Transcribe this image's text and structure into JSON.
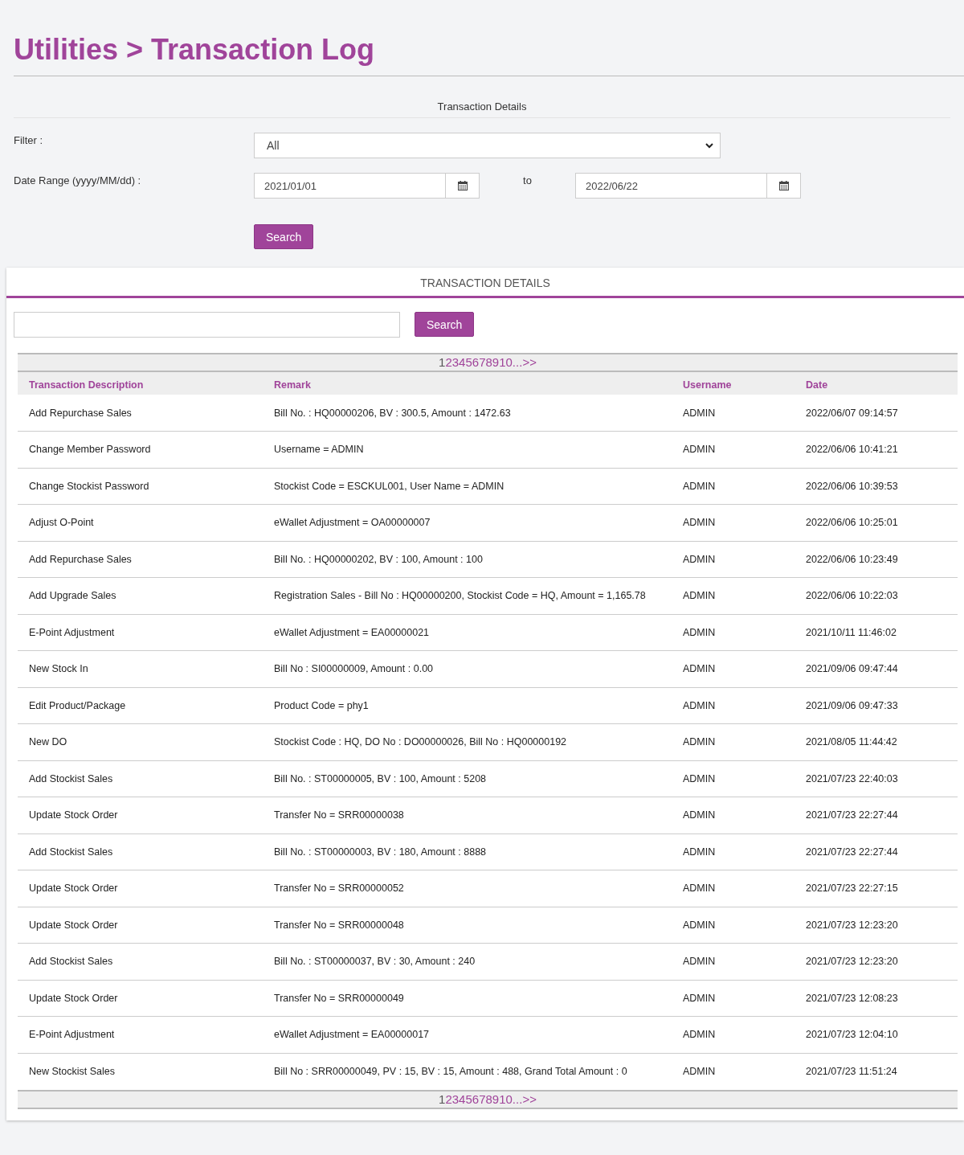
{
  "page_title": "Utilities > Transaction Log",
  "form": {
    "section_title": "Transaction Details",
    "filter_label": "Filter :",
    "filter_value": "All",
    "date_label": "Date Range (yyyy/MM/dd) :",
    "date_from": "2021/01/01",
    "to_label": "to",
    "date_to": "2022/06/22",
    "search_button": "Search"
  },
  "panel": {
    "title": "TRANSACTION DETAILS",
    "search_button": "Search",
    "pager_top": [
      {
        "label": "1",
        "selected": true
      },
      {
        "label": "2",
        "selected": false
      },
      {
        "label": "3",
        "selected": false
      },
      {
        "label": "4",
        "selected": false
      },
      {
        "label": "5",
        "selected": false
      },
      {
        "label": "6",
        "selected": false
      },
      {
        "label": "7",
        "selected": false
      },
      {
        "label": "8",
        "selected": false
      },
      {
        "label": "9",
        "selected": false
      },
      {
        "label": "10",
        "selected": false
      },
      {
        "label": "...",
        "selected": false
      },
      {
        "label": ">>",
        "selected": false
      }
    ],
    "columns": [
      "Transaction Description",
      "Remark",
      "Username",
      "Date"
    ],
    "rows": [
      [
        "Add Repurchase Sales",
        "Bill No. : HQ00000206, BV : 300.5, Amount : 1472.63",
        "ADMIN",
        "2022/06/07 09:14:57"
      ],
      [
        "Change Member Password",
        "Username = ADMIN",
        "ADMIN",
        "2022/06/06 10:41:21"
      ],
      [
        "Change Stockist Password",
        "Stockist Code = ESCKUL001, User Name = ADMIN",
        "ADMIN",
        "2022/06/06 10:39:53"
      ],
      [
        "Adjust O-Point",
        "eWallet Adjustment = OA00000007",
        "ADMIN",
        "2022/06/06 10:25:01"
      ],
      [
        "Add Repurchase Sales",
        "Bill No. : HQ00000202, BV : 100, Amount : 100",
        "ADMIN",
        "2022/06/06 10:23:49"
      ],
      [
        "Add Upgrade Sales",
        "Registration Sales - Bill No : HQ00000200, Stockist Code = HQ, Amount = 1,165.78",
        "ADMIN",
        "2022/06/06 10:22:03"
      ],
      [
        "E-Point Adjustment",
        "eWallet Adjustment = EA00000021",
        "ADMIN",
        "2021/10/11 11:46:02"
      ],
      [
        "New Stock In",
        "Bill No : SI00000009, Amount : 0.00",
        "ADMIN",
        "2021/09/06 09:47:44"
      ],
      [
        "Edit Product/Package",
        "Product Code = phy1",
        "ADMIN",
        "2021/09/06 09:47:33"
      ],
      [
        "New DO",
        "Stockist Code : HQ, DO No : DO00000026, Bill No : HQ00000192",
        "ADMIN",
        "2021/08/05 11:44:42"
      ],
      [
        "Add Stockist Sales",
        "Bill No. : ST00000005, BV : 100, Amount : 5208",
        "ADMIN",
        "2021/07/23 22:40:03"
      ],
      [
        "Update Stock Order",
        "Transfer No = SRR00000038",
        "ADMIN",
        "2021/07/23 22:27:44"
      ],
      [
        "Add Stockist Sales",
        "Bill No. : ST00000003, BV : 180, Amount : 8888",
        "ADMIN",
        "2021/07/23 22:27:44"
      ],
      [
        "Update Stock Order",
        "Transfer No = SRR00000052",
        "ADMIN",
        "2021/07/23 22:27:15"
      ],
      [
        "Update Stock Order",
        "Transfer No = SRR00000048",
        "ADMIN",
        "2021/07/23 12:23:20"
      ],
      [
        "Add Stockist Sales",
        "Bill No. : ST00000037, BV : 30, Amount : 240",
        "ADMIN",
        "2021/07/23 12:23:20"
      ],
      [
        "Update Stock Order",
        "Transfer No = SRR00000049",
        "ADMIN",
        "2021/07/23 12:08:23"
      ],
      [
        "E-Point Adjustment",
        "eWallet Adjustment = EA00000017",
        "ADMIN",
        "2021/07/23 12:04:10"
      ],
      [
        "New Stockist Sales",
        "Bill No : SRR00000049, PV : 15, BV : 15, Amount : 488, Grand Total Amount : 0",
        "ADMIN",
        "2021/07/23 11:51:24"
      ]
    ],
    "pager_bottom": [
      {
        "label": "1",
        "selected": true
      },
      {
        "label": "2",
        "selected": false
      },
      {
        "label": "3",
        "selected": false
      },
      {
        "label": "4",
        "selected": false
      },
      {
        "label": "5",
        "selected": false
      },
      {
        "label": "6",
        "selected": false
      },
      {
        "label": "7",
        "selected": false
      },
      {
        "label": "8",
        "selected": false
      },
      {
        "label": "9",
        "selected": false
      },
      {
        "label": "10",
        "selected": false
      },
      {
        "label": "...",
        "selected": false
      },
      {
        "label": ">>",
        "selected": false
      }
    ]
  }
}
